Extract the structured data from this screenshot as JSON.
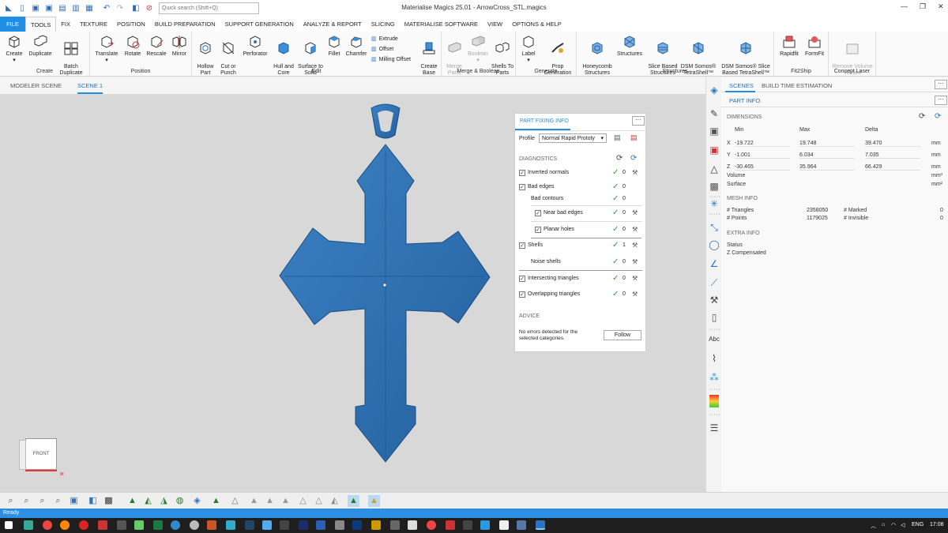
{
  "titlebar": {
    "title": "Materialise Magics 25.01 - ArrowCross_STL.magics",
    "quick_search_placeholder": "Quick search (Shift+Q)"
  },
  "ribbon_tabs": [
    "FILE",
    "TOOLS",
    "FIX",
    "TEXTURE",
    "POSITION",
    "BUILD PREPARATION",
    "SUPPORT GENERATION",
    "ANALYZE & REPORT",
    "SLICING",
    "MATERIALISE SOFTWARE",
    "VIEW",
    "OPTIONS & HELP"
  ],
  "ribbon": {
    "create": {
      "label": "Create",
      "buttons": [
        "Create",
        "Duplicate",
        "Batch\nDuplicate"
      ]
    },
    "position": {
      "label": "Position",
      "buttons": [
        "Translate",
        "Rotate",
        "Rescale",
        "Mirror"
      ]
    },
    "edit": {
      "label": "Edit",
      "buttons": [
        "Hollow\nPart",
        "Cut or\nPunch",
        "Perforator",
        "Hull and\nCore",
        "Surface to\nSolid",
        "Fillet",
        "Chamfer"
      ],
      "small": [
        "Extrude",
        "Offset",
        "Milling Offset"
      ],
      "extra": "Create\nBase"
    },
    "merge": {
      "label": "Merge & Boolean",
      "buttons": [
        "Merge\nParts",
        "Boolean",
        "Shells To\nParts"
      ]
    },
    "generate": {
      "label": "Generate",
      "buttons": [
        "Label",
        "Prop\nGeneration"
      ]
    },
    "structures": {
      "label": "Structures",
      "buttons": [
        "Honeycomb\nStructures",
        "Structures",
        "Slice Based\nStructures",
        "DSM Somos®\nTetraShell™",
        "DSM Somos® Slice\nBased TetraShell™"
      ]
    },
    "fit2ship": {
      "label": "Fit2Ship",
      "buttons": [
        "Rapidfit",
        "FormFit"
      ]
    },
    "concept": {
      "label": "Concept Laser",
      "buttons": [
        "Remove Volume\nWizard"
      ]
    }
  },
  "scene_tabs": [
    "MODELER SCENE",
    "SCENE 1"
  ],
  "viewcube_label": "FRONT",
  "part_fixing": {
    "title": "PART FIXING INFO",
    "profile_label": "Profile",
    "profile_value": "Normal Rapid Prototy",
    "diagnostics_label": "DIAGNOSTICS",
    "rows": [
      {
        "label": "Inverted normals",
        "count": "0",
        "checkbox": true,
        "wrench": true,
        "indent": 0
      },
      {
        "label": "Bad edges",
        "count": "0",
        "checkbox": true,
        "wrench": false,
        "indent": 0
      },
      {
        "label": "Bad contours",
        "count": "0",
        "checkbox": false,
        "wrench": false,
        "indent": 1
      },
      {
        "label": "Near bad edges",
        "count": "0",
        "checkbox": true,
        "wrench": true,
        "indent": 2
      },
      {
        "label": "Planar holes",
        "count": "0",
        "checkbox": true,
        "wrench": true,
        "indent": 2
      },
      {
        "label": "Shells",
        "count": "1",
        "checkbox": true,
        "wrench": true,
        "indent": 0
      },
      {
        "label": "Noise shells",
        "count": "0",
        "checkbox": false,
        "wrench": true,
        "indent": 1
      },
      {
        "label": "Intersecting triangles",
        "count": "0",
        "checkbox": true,
        "wrench": true,
        "indent": 0
      },
      {
        "label": "Overlapping triangles",
        "count": "0",
        "checkbox": true,
        "wrench": true,
        "indent": 0
      }
    ],
    "advice_label": "ADVICE",
    "advice_text": "No errors detected for the selected categories.",
    "follow_label": "Follow"
  },
  "right_panel": {
    "tabs": [
      "SCENES",
      "BUILD TIME ESTIMATION"
    ],
    "subtab": "PART INFO",
    "dimensions_label": "DIMENSIONS",
    "col_headers": [
      "Min",
      "Max",
      "Delta"
    ],
    "dims": [
      {
        "axis": "X",
        "min": "-19.722",
        "max": "19.748",
        "delta": "39.470",
        "unit": "mm"
      },
      {
        "axis": "Y",
        "min": "-1.001",
        "max": "6.034",
        "delta": "7.035",
        "unit": "mm"
      },
      {
        "axis": "Z",
        "min": "-30.465",
        "max": "35.964",
        "delta": "66.429",
        "unit": "mm"
      }
    ],
    "volume_label": "Volume",
    "volume_unit": "mm³",
    "surface_label": "Surface",
    "surface_unit": "mm²",
    "mesh_info_label": "MESH INFO",
    "triangles_label": "# Triangles",
    "triangles_value": "2358050",
    "marked_label": "# Marked",
    "marked_value": "0",
    "points_label": "# Points",
    "points_value": "1179025",
    "invisible_label": "# Invisible",
    "invisible_value": "0",
    "extra_info_label": "EXTRA INFO",
    "status_label": "Status",
    "zcomp_label": "Z Compensated"
  },
  "statusbar": {
    "text": "Ready"
  },
  "taskbar": {
    "lang": "ENG",
    "time": "17:08"
  },
  "colors": {
    "accent": "#1f8ee6",
    "model": "#2f6fad",
    "ok": "#2aa02a"
  }
}
